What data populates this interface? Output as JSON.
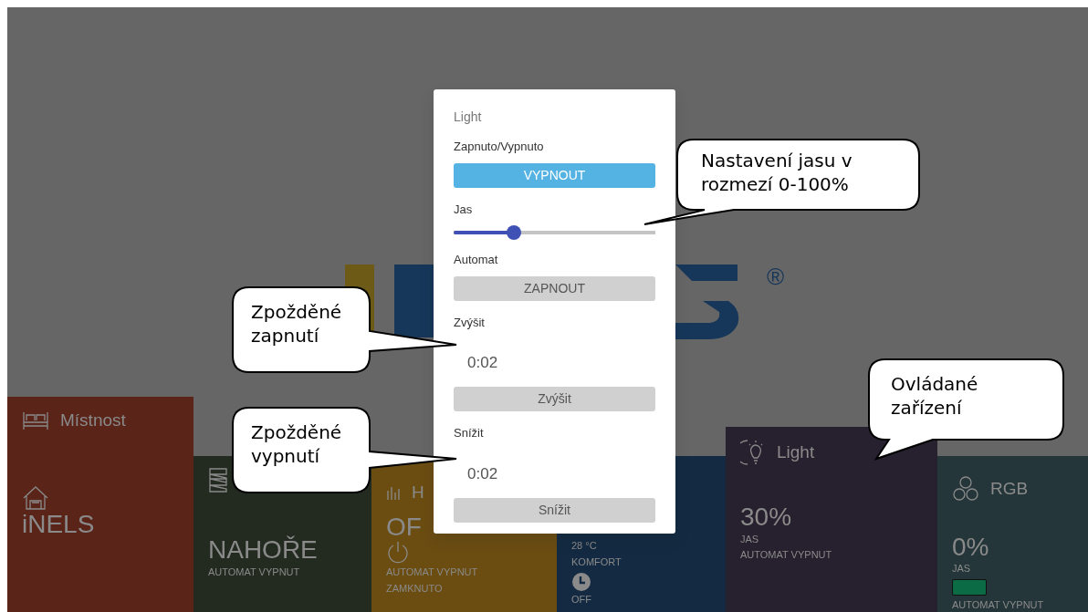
{
  "logo": {
    "mark": "®"
  },
  "dialog": {
    "title": "Light",
    "sections": [
      {
        "kind": "button",
        "label": "Zapnuto/Vypnuto",
        "button": "VYPNOUT",
        "active": true
      },
      {
        "kind": "slider",
        "label": "Jas",
        "level": 0.3
      },
      {
        "kind": "button",
        "label": "Automat",
        "button": "ZAPNOUT",
        "active": false
      },
      {
        "kind": "timer",
        "label": "Zvýšit",
        "value": "0:02",
        "button": "Zvýšit"
      },
      {
        "kind": "timer",
        "label": "Snížit",
        "value": "0:02",
        "button": "Snížit"
      }
    ]
  },
  "tiles": [
    {
      "kind": "room",
      "title": "Místnost",
      "value": "iNELS",
      "color": "#5a2419"
    },
    {
      "kind": "blinds",
      "value": "NAHOŘE",
      "lines": [
        "AUTOMAT VYPNUT"
      ],
      "color": "#232b21"
    },
    {
      "kind": "switch",
      "title": "H",
      "value": "OF",
      "lines": [
        "AUTOMAT VYPNUT",
        "ZAMKNUTO"
      ],
      "color": "#6b4d12"
    },
    {
      "kind": "thermo",
      "lines": [
        "28 °C",
        "KOMFORT"
      ],
      "footer": "OFF",
      "color": "#132a42"
    },
    {
      "kind": "light",
      "title": "Light",
      "value": "30%",
      "lines": [
        "JAS",
        "AUTOMAT VYPNUT"
      ],
      "color": "#27202e"
    },
    {
      "kind": "rgb",
      "title": "RGB",
      "value": "0%",
      "lines": [
        "JAS"
      ],
      "swatch": {
        "color": "#0b6b45"
      },
      "footer": "AUTOMAT VYPNUT",
      "color": "#25363a"
    }
  ],
  "callouts": [
    {
      "text": "Nastavení jasu v rozmezí 0-100%"
    },
    {
      "text": "Zpožděné zapnutí"
    },
    {
      "text": "Zpožděné vypnutí"
    },
    {
      "text": "Ovládané zařízení"
    }
  ]
}
